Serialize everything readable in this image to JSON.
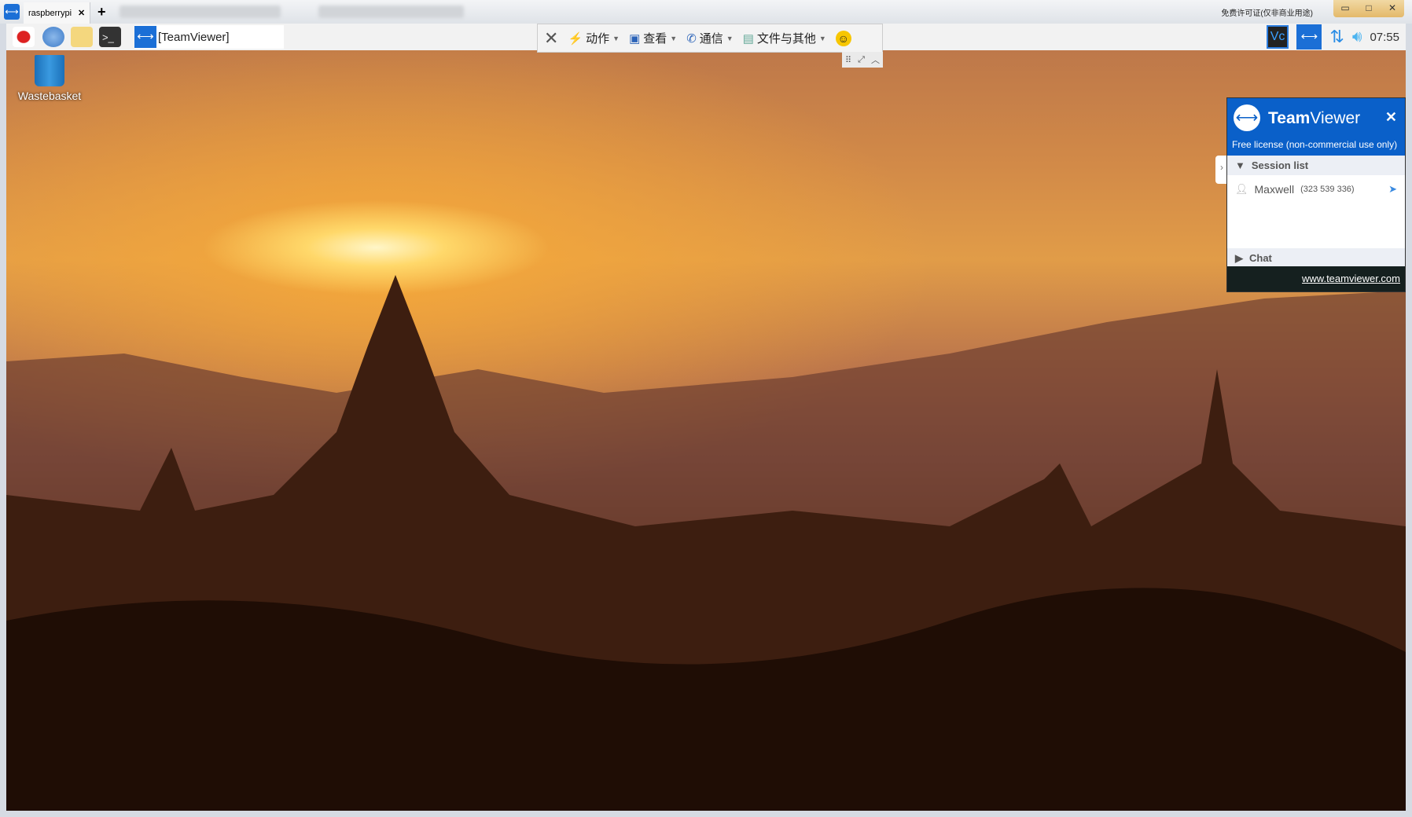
{
  "window": {
    "tab_label": "raspberrypi",
    "new_tab": "+",
    "license_note": "免费许可证(仅非商业用途)",
    "minimize": "▭",
    "maximize": "□",
    "close": "✕"
  },
  "remote_panel": {
    "taskbar_item": "[TeamViewer]",
    "clock": "07:55"
  },
  "toolbar": {
    "close": "✕",
    "actions": "动作",
    "view": "查看",
    "communicate": "通信",
    "files": "文件与其他",
    "emoji": "☺"
  },
  "desktop": {
    "wastebasket": "Wastebasket"
  },
  "tv_panel": {
    "title_bold": "Team",
    "title_light": "Viewer",
    "close": "✕",
    "license": "Free license (non-commercial use only)",
    "session_list": "Session list",
    "session_name": "Maxwell",
    "session_id": "(323 539 336)",
    "chat": "Chat",
    "link": "www.teamviewer.com"
  },
  "colors": {
    "tv_blue": "#0a60c9",
    "footer": "#15201f"
  }
}
